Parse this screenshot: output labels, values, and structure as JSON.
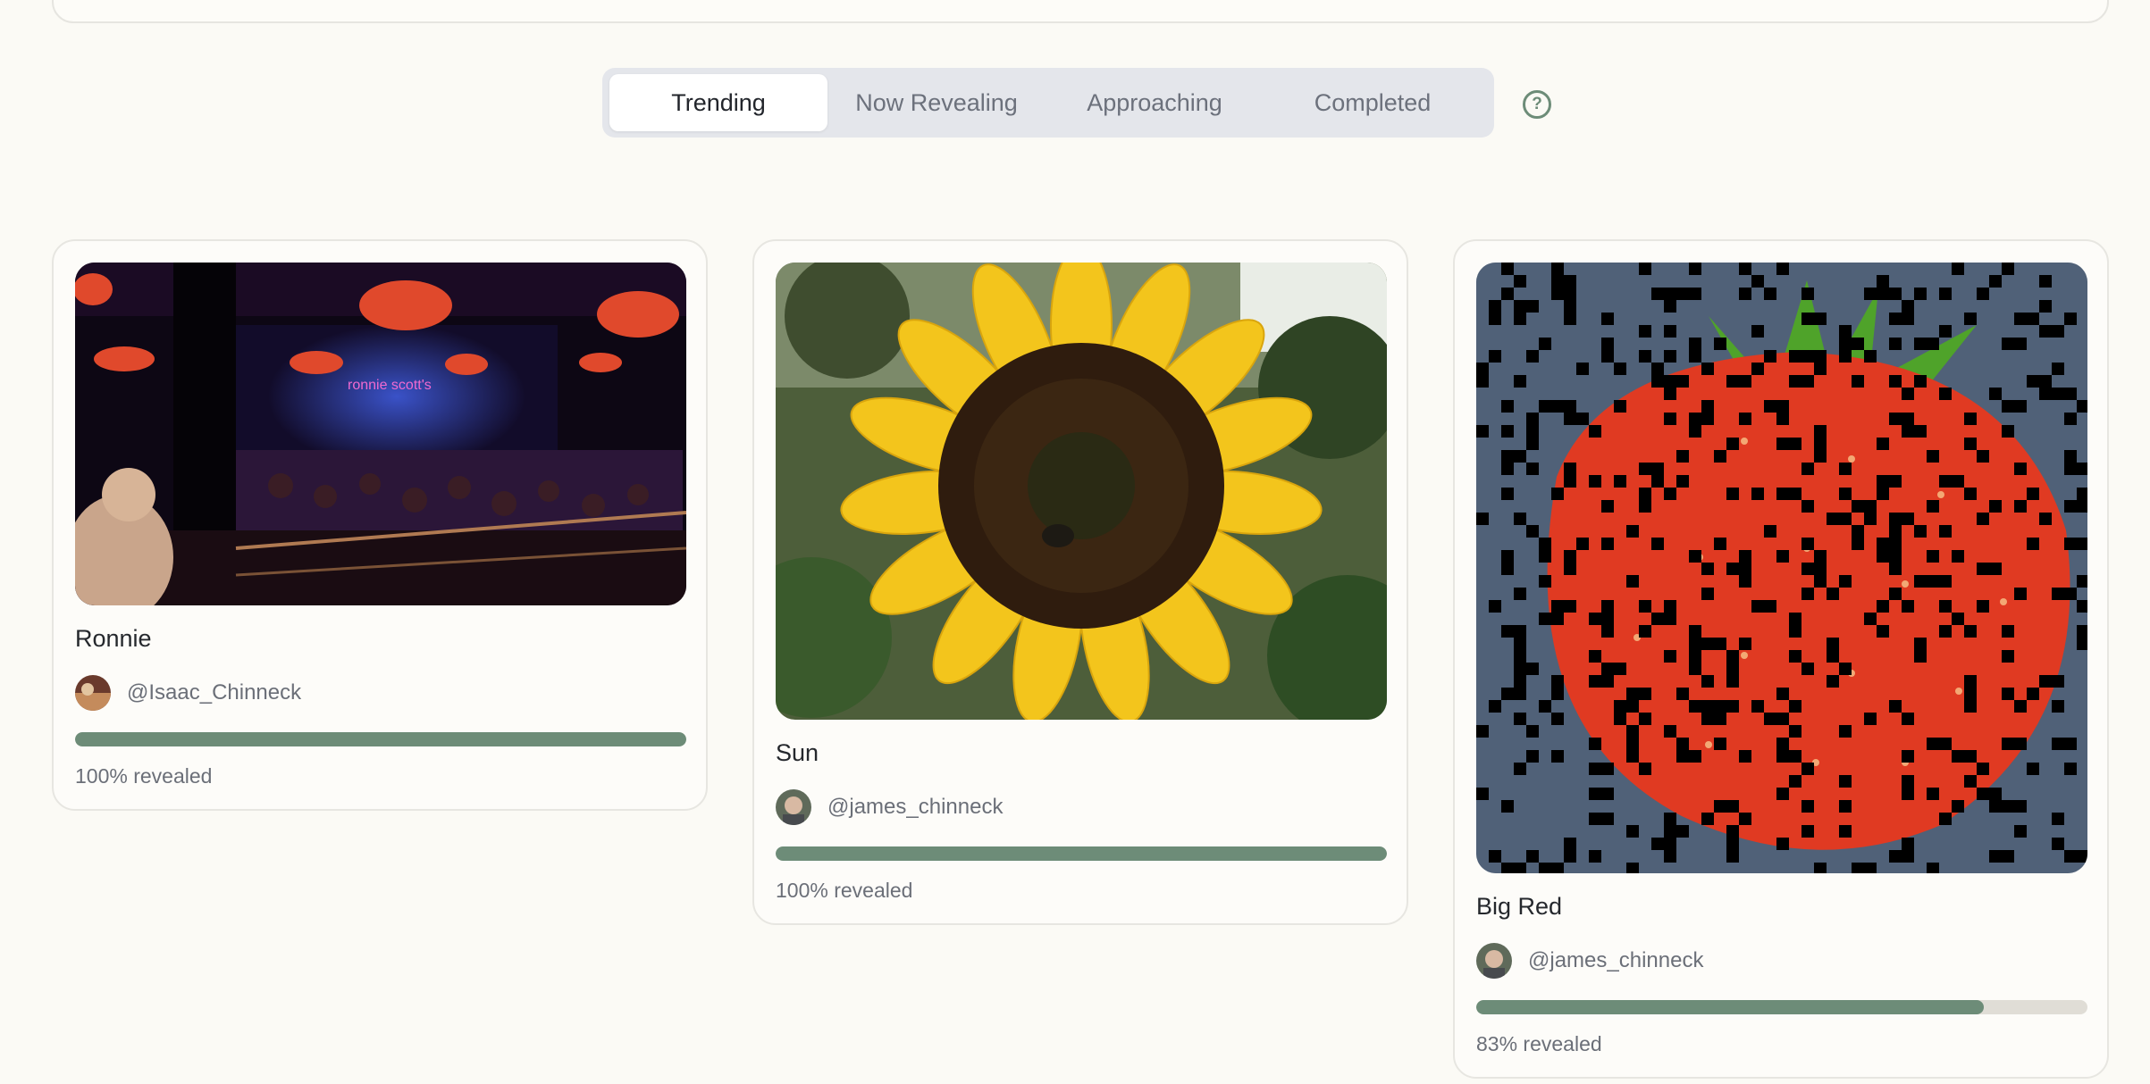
{
  "tabs": [
    {
      "label": "Trending"
    },
    {
      "label": "Now Revealing"
    },
    {
      "label": "Approaching"
    },
    {
      "label": "Completed"
    }
  ],
  "active_tab": "Trending",
  "help_icon": "question-circle-icon",
  "colors": {
    "background": "#fbfaf5",
    "accent": "#6d8c78",
    "progress_track": "#e0ddd6"
  },
  "cards": [
    {
      "title": "Ronnie",
      "username": "@Isaac_Chinneck",
      "image": "jazz-club-photo",
      "revealed_fraction": 1.0,
      "revealed_label": "100% revealed"
    },
    {
      "title": "Sun",
      "username": "@james_chinneck",
      "image": "sunflower-photo",
      "revealed_fraction": 1.0,
      "revealed_label": "100% revealed"
    },
    {
      "title": "Big Red",
      "username": "@james_chinneck",
      "image": "strawberry-photo",
      "revealed_fraction": 0.83,
      "revealed_label": "83% revealed"
    }
  ]
}
